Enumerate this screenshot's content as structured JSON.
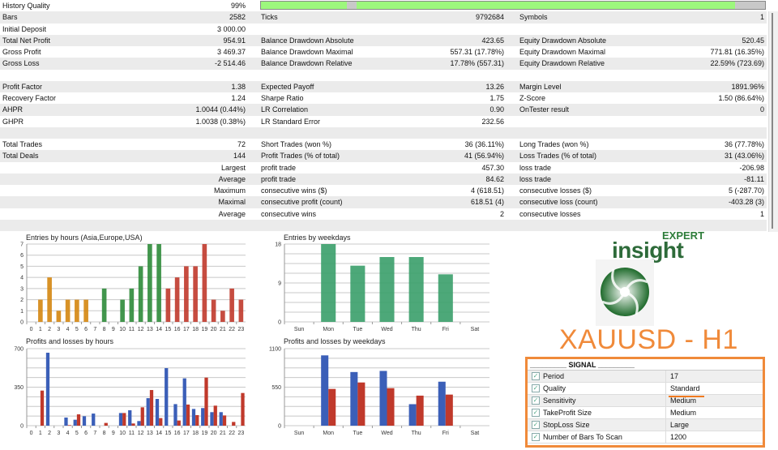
{
  "stats": {
    "quality_fill": 0.99,
    "rows": [
      [
        [
          "History Quality",
          "99%"
        ],
        [
          "",
          ""
        ],
        [
          "",
          ""
        ]
      ],
      [
        [
          "Bars",
          "2582"
        ],
        [
          "Ticks",
          "9792684"
        ],
        [
          "Symbols",
          "1"
        ]
      ],
      [
        [
          "Initial Deposit",
          "3 000.00"
        ],
        [
          "",
          ""
        ],
        [
          "",
          ""
        ]
      ],
      [
        [
          "Total Net Profit",
          "954.91"
        ],
        [
          "Balance Drawdown Absolute",
          "423.65"
        ],
        [
          "Equity Drawdown Absolute",
          "520.45"
        ]
      ],
      [
        [
          "Gross Profit",
          "3 469.37"
        ],
        [
          "Balance Drawdown Maximal",
          "557.31 (17.78%)"
        ],
        [
          "Equity Drawdown Maximal",
          "771.81 (16.35%)"
        ]
      ],
      [
        [
          "Gross Loss",
          "-2 514.46"
        ],
        [
          "Balance Drawdown Relative",
          "17.78% (557.31)"
        ],
        [
          "Equity Drawdown Relative",
          "22.59% (723.69)"
        ]
      ],
      [
        [
          "",
          ""
        ],
        [
          "",
          ""
        ],
        [
          "",
          ""
        ]
      ],
      [
        [
          "Profit Factor",
          "1.38"
        ],
        [
          "Expected Payoff",
          "13.26"
        ],
        [
          "Margin Level",
          "1891.96%"
        ]
      ],
      [
        [
          "Recovery Factor",
          "1.24"
        ],
        [
          "Sharpe Ratio",
          "1.75"
        ],
        [
          "Z-Score",
          "1.50 (86.64%)"
        ]
      ],
      [
        [
          "AHPR",
          "1.0044 (0.44%)"
        ],
        [
          "LR Correlation",
          "0.90"
        ],
        [
          "OnTester result",
          "0"
        ]
      ],
      [
        [
          "GHPR",
          "1.0038 (0.38%)"
        ],
        [
          "LR Standard Error",
          "232.56"
        ],
        [
          "",
          ""
        ]
      ],
      [
        [
          "",
          ""
        ],
        [
          "",
          ""
        ],
        [
          "",
          ""
        ]
      ],
      [
        [
          "Total Trades",
          "72"
        ],
        [
          "Short Trades (won %)",
          "36 (36.11%)"
        ],
        [
          "Long Trades (won %)",
          "36 (77.78%)"
        ]
      ],
      [
        [
          "Total Deals",
          "144"
        ],
        [
          "Profit Trades (% of total)",
          "41 (56.94%)"
        ],
        [
          "Loss Trades (% of total)",
          "31 (43.06%)"
        ]
      ],
      [
        [
          "",
          "Largest"
        ],
        [
          "profit trade",
          "457.30"
        ],
        [
          "loss trade",
          "-206.98"
        ]
      ],
      [
        [
          "",
          "Average"
        ],
        [
          "profit trade",
          "84.62"
        ],
        [
          "loss trade",
          "-81.11"
        ]
      ],
      [
        [
          "",
          "Maximum"
        ],
        [
          "consecutive wins ($)",
          "4 (618.51)"
        ],
        [
          "consecutive losses ($)",
          "5 (-287.70)"
        ]
      ],
      [
        [
          "",
          "Maximal"
        ],
        [
          "consecutive profit (count)",
          "618.51 (4)"
        ],
        [
          "consecutive loss (count)",
          "-403.28 (3)"
        ]
      ],
      [
        [
          "",
          "Average"
        ],
        [
          "consecutive wins",
          "2"
        ],
        [
          "consecutive losses",
          "1"
        ]
      ],
      [
        [
          "",
          ""
        ],
        [
          "",
          ""
        ],
        [
          "",
          ""
        ]
      ]
    ]
  },
  "chart_data": [
    {
      "type": "bar",
      "title": "Entries by hours (Asia,Europe,USA)",
      "categories": [
        "0",
        "1",
        "2",
        "3",
        "4",
        "5",
        "6",
        "7",
        "8",
        "9",
        "10",
        "11",
        "12",
        "13",
        "14",
        "15",
        "16",
        "17",
        "18",
        "19",
        "20",
        "21",
        "22",
        "23"
      ],
      "values": [
        0,
        2,
        4,
        1,
        2,
        2,
        2,
        0,
        3,
        0,
        2,
        3,
        5,
        7,
        7,
        3,
        4,
        5,
        5,
        7,
        2,
        1,
        3,
        2
      ],
      "yticks": [
        "0",
        "1",
        "2",
        "3",
        "4",
        "5",
        "6",
        "7"
      ],
      "ylim": [
        0,
        7
      ],
      "colors_by_session": {
        "asia": "#d4860f",
        "europe": "#2e8b3a",
        "usa": "#c0392b"
      }
    },
    {
      "type": "bar",
      "title": "Profits and losses by hours",
      "categories": [
        "0",
        "1",
        "2",
        "3",
        "4",
        "5",
        "6",
        "7",
        "8",
        "9",
        "10",
        "11",
        "12",
        "13",
        "14",
        "15",
        "16",
        "17",
        "18",
        "19",
        "20",
        "21",
        "22",
        "23"
      ],
      "series": [
        {
          "values": [
            0,
            0,
            663,
            0,
            74,
            54,
            86,
            110,
            0,
            0,
            115,
            140,
            42,
            250,
            243,
            523,
            196,
            430,
            152,
            160,
            123,
            123,
            0,
            0
          ],
          "color": "#3b5fb8"
        },
        {
          "values": [
            0,
            319,
            0,
            0,
            5,
            103,
            0,
            0,
            25,
            0,
            115,
            20,
            167,
            324,
            69,
            0,
            47,
            192,
            96,
            437,
            182,
            93,
            34,
            297
          ],
          "color": "#c0392b"
        }
      ],
      "yticks": [
        "0",
        "350",
        "700"
      ],
      "ylim": [
        0,
        700
      ]
    },
    {
      "type": "bar",
      "title": "Entries by weekdays",
      "categories": [
        "Sun",
        "Mon",
        "Tue",
        "Wed",
        "Thu",
        "Fri",
        "Sat"
      ],
      "values": [
        0,
        18,
        13,
        15,
        15,
        11,
        0
      ],
      "yticks": [
        "0",
        "9",
        "18"
      ],
      "ylim": [
        0,
        18
      ],
      "color": "#3a9e6a"
    },
    {
      "type": "bar",
      "title": "Profits and losses by weekdays",
      "categories": [
        "Sun",
        "Mon",
        "Tue",
        "Wed",
        "Thu",
        "Fri",
        "Sat"
      ],
      "series": [
        {
          "values": [
            0,
            1004,
            766,
            782,
            307,
            628,
            0
          ],
          "color": "#3b5fb8"
        },
        {
          "values": [
            0,
            525,
            617,
            536,
            429,
            444,
            0
          ],
          "color": "#c0392b"
        }
      ],
      "yticks": [
        "0",
        "550",
        "1100"
      ],
      "ylim": [
        0,
        1100
      ]
    }
  ],
  "branding": {
    "expert": "EXPERT",
    "insight": "insight",
    "pair": "XAUUSD - H1"
  },
  "signal": {
    "header": "_________ SIGNAL _________",
    "rows": [
      {
        "name": "Period",
        "value": "17"
      },
      {
        "name": "Quality",
        "value": "Standard"
      },
      {
        "name": "Sensitivity",
        "value": "Medium"
      },
      {
        "name": "TakeProfit Size",
        "value": "Medium"
      },
      {
        "name": "StopLoss Size",
        "value": "Large"
      },
      {
        "name": "Number of Bars To Scan",
        "value": "1200"
      }
    ]
  }
}
